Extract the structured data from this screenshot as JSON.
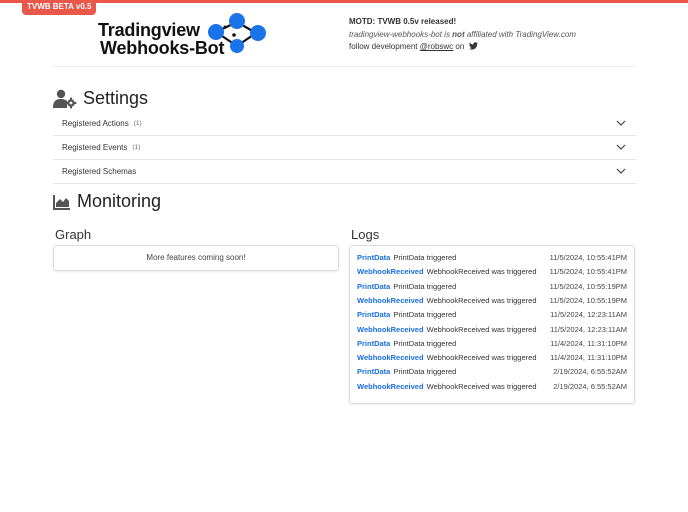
{
  "badge": "TVWB BETA v0.5",
  "logo": {
    "line1": "Tradingview",
    "line2": "Webhooks-Bot"
  },
  "motd": {
    "title": "MOTD: TVWB 0.5v released!",
    "desc_prefix": "tradingview-webhooks-bot is",
    "desc_not": "not",
    "desc_suffix": "affiliated with TradingView.com",
    "follow_prefix": "follow development",
    "follow_handle": "@robswc",
    "follow_suffix": "on"
  },
  "settings": {
    "title": "Settings",
    "items": [
      {
        "label": "Registered Actions",
        "count": "(1)"
      },
      {
        "label": "Registered Events",
        "count": "(1)"
      },
      {
        "label": "Registered Schemas",
        "count": ""
      }
    ]
  },
  "monitoring": {
    "title": "Monitoring",
    "graph_title": "Graph",
    "graph_message": "More features coming soon!",
    "logs_title": "Logs",
    "logs": [
      {
        "tag": "PrintData",
        "msg": "PrintData triggered",
        "ts": "11/5/2024, 10:55:41PM"
      },
      {
        "tag": "WebhookReceived",
        "msg": "WebhookReceived was triggered",
        "ts": "11/5/2024, 10:55:41PM"
      },
      {
        "tag": "PrintData",
        "msg": "PrintData triggered",
        "ts": "11/5/2024, 10:55:19PM"
      },
      {
        "tag": "WebhookReceived",
        "msg": "WebhookReceived was triggered",
        "ts": "11/5/2024, 10:55:19PM"
      },
      {
        "tag": "PrintData",
        "msg": "PrintData triggered",
        "ts": "11/5/2024, 12:23:11AM"
      },
      {
        "tag": "WebhookReceived",
        "msg": "WebhookReceived was triggered",
        "ts": "11/5/2024, 12:23:11AM"
      },
      {
        "tag": "PrintData",
        "msg": "PrintData triggered",
        "ts": "11/4/2024, 11:31:10PM"
      },
      {
        "tag": "WebhookReceived",
        "msg": "WebhookReceived was triggered",
        "ts": "11/4/2024, 11:31:10PM"
      },
      {
        "tag": "PrintData",
        "msg": "PrintData triggered",
        "ts": "2/19/2024, 6:55:52AM"
      },
      {
        "tag": "WebhookReceived",
        "msg": "WebhookReceived was triggered",
        "ts": "2/19/2024, 6:55:52AM"
      }
    ]
  },
  "colors": {
    "accent": "#e8574a",
    "link": "#1a6fe0",
    "logo_blue": "#1a73e8"
  },
  "icons": {
    "settings": "user-gear-icon",
    "monitoring": "area-chart-icon",
    "chevron": "chevron-down-icon",
    "twitter": "twitter-icon"
  }
}
